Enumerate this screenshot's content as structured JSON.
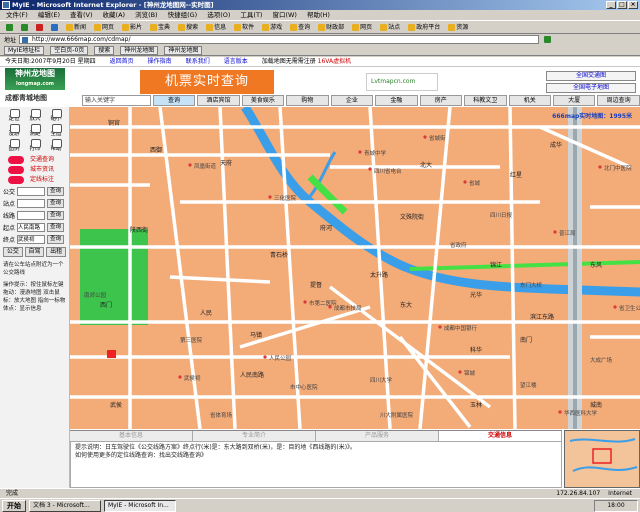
{
  "window": {
    "title": "MyIE - Microsoft Internet Explorer - [神州龙地图网--实时图]"
  },
  "menu": [
    "文件(F)",
    "编辑(E)",
    "查看(V)",
    "收藏(A)",
    "浏览(B)",
    "快捷组(G)",
    "选项(O)",
    "工具(T)",
    "窗口(W)",
    "帮助(H)"
  ],
  "toolbar": [
    "新闻",
    "网页",
    "影片",
    "宝典",
    "搜索",
    "信息",
    "软件",
    "游戏",
    "查询",
    "财政部",
    "网页",
    "站点",
    "政府平台",
    "资源"
  ],
  "address": {
    "label": "地址",
    "value": "http://www.666map.com/cdmap/"
  },
  "links": [
    "MyIE地址栏",
    "空白页-0页",
    "搜索",
    "神州龙地图",
    "神州龙地图"
  ],
  "page": {
    "topinfo": {
      "date": "今天日期:2007年9月20日 星期四",
      "nav1": "返回首页",
      "nav2": "操作指南",
      "nav3": "联系我们",
      "nav4": "语言版本",
      "promo": "加载地图无需需注册",
      "promo_red": "16VA虚拟机"
    },
    "logo": {
      "name": "神州龙地图",
      "url": "longmap.com"
    },
    "banner": "机票实时查询",
    "ad": "Lvtmapcn.com",
    "map_buttons": [
      "全国交通图",
      "全国电子地图"
    ],
    "site_title": "成都青城地图",
    "search_placeholder": "输入关键字",
    "categories": [
      "查询",
      "酒店宾馆",
      "美食娱乐",
      "购物",
      "企业",
      "金融",
      "房产",
      "科教文卫",
      "机关",
      "大厦",
      "周边查询"
    ]
  },
  "left": {
    "tools": [
      "定位",
      "放大",
      "缩小",
      "漫游",
      "测距",
      "全图",
      "图例",
      "打印",
      "帮助"
    ],
    "functions": [
      "交通查询",
      "城市资讯",
      "定线标注"
    ],
    "search": [
      {
        "label": "公交",
        "btn": "查询"
      },
      {
        "label": "站点",
        "btn": "查询"
      },
      {
        "label": "线路",
        "btn": "查询"
      },
      {
        "label": "起点",
        "btn": "查询",
        "extra": "人民南路"
      },
      {
        "label": "终点",
        "btn": "查询",
        "extra": "武侯祠"
      }
    ],
    "bottom_buttons": [
      "公交",
      "自驾",
      "出租"
    ],
    "note1": "请在公车站点附近为一个公交路线",
    "note2": "操作提示：按住鼠标左键拖动：漫游地图 双击鼠标：放大地图 指向一标物体点：显示信息"
  },
  "map": {
    "scale": "666map实时地图：1995米",
    "streets": [
      "铜官",
      "天府",
      "陕西街",
      "文殊院街",
      "太升路",
      "青石桥",
      "提督",
      "人民",
      "府河",
      "红星",
      "东大",
      "锦江",
      "南门",
      "玉林",
      "城南",
      "科华",
      "北大",
      "成华",
      "光华",
      "滨江东路",
      "东风",
      "西御",
      "人民南路",
      "武侯",
      "西门",
      "马镇"
    ],
    "pois": [
      "青城中学",
      "四川省电台",
      "省城街",
      "凤凰街道",
      "省城",
      "普江局",
      "北门中医院",
      "三化医院",
      "市第二医院",
      "成都市技局",
      "人民公园",
      "武侯祠",
      "省体育场",
      "成都中国银行",
      "锦城",
      "华西医科大学",
      "省卫生公署",
      "望江楼",
      "第三医院",
      "四川大学",
      "川大附属医院",
      "市中心医院",
      "四川日报",
      "东门大桥",
      "大成广场",
      "省政府"
    ],
    "park": "南郊公园"
  },
  "bottom_tabs": [
    "基本信息",
    "专业简介",
    "产品服务",
    "交通信息"
  ],
  "info": "提示说明：日车驾驶位《公交线路方案》终点行(米)是：东大路到双桥(米)，是：目的地《西线路的(米)》。",
  "info2": "如何使用更多的定位线路查询：找出交线路查询》",
  "status": {
    "done": "完成",
    "ip": "172.26.84.107",
    "zone": "Internet"
  },
  "taskbar": {
    "start": "开始",
    "tasks": [
      "文档 3 - Microsoft...",
      "MyIE - Microsoft In..."
    ],
    "time": "18:00"
  }
}
